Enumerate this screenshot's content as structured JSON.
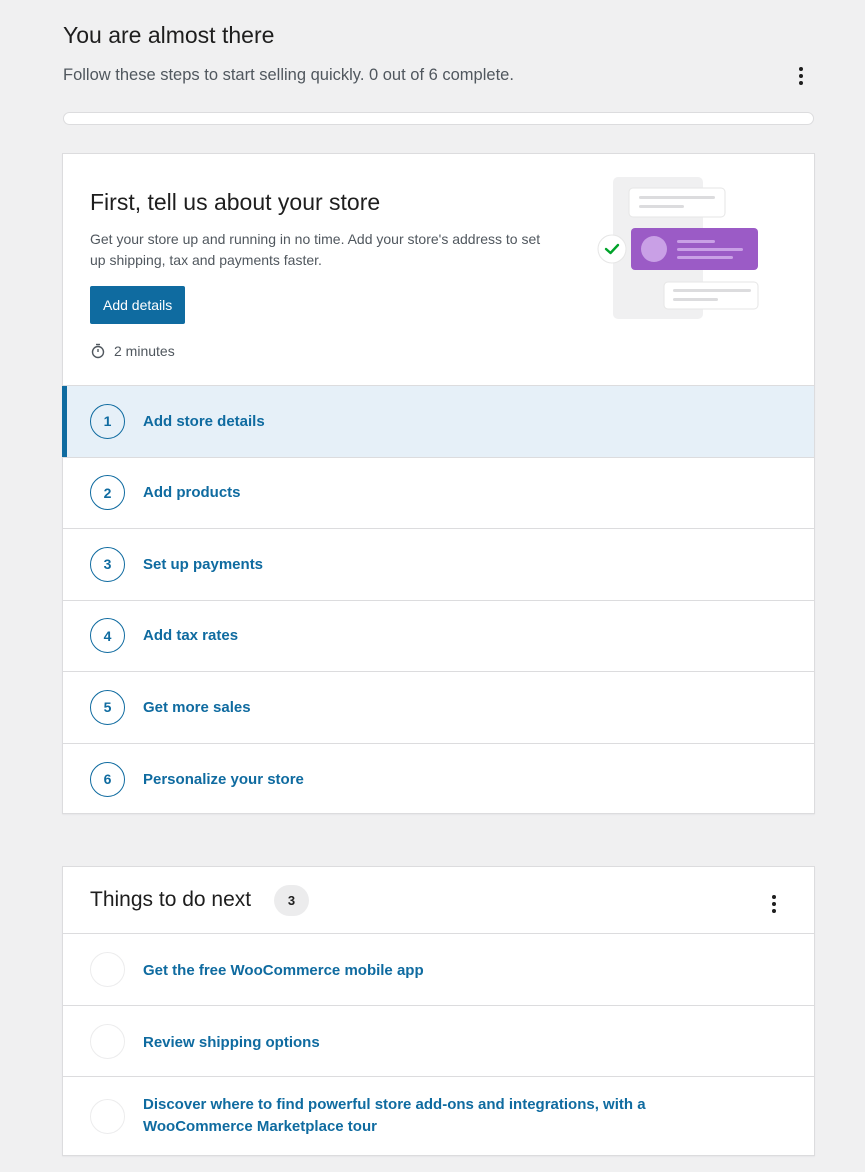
{
  "header": {
    "title": "You are almost there",
    "subtitle": "Follow these steps to start selling quickly. 0 out of 6 complete."
  },
  "progress": {
    "completed": 0,
    "total": 6
  },
  "setup": {
    "hero_title": "First, tell us about your store",
    "hero_description": "Get your store up and running in no time. Add your store's address to set up shipping, tax and payments faster.",
    "button_label": "Add details",
    "time_estimate": "2 minutes",
    "tasks": [
      {
        "number": "1",
        "label": "Add store details"
      },
      {
        "number": "2",
        "label": "Add products"
      },
      {
        "number": "3",
        "label": "Set up payments"
      },
      {
        "number": "4",
        "label": "Add tax rates"
      },
      {
        "number": "5",
        "label": "Get more sales"
      },
      {
        "number": "6",
        "label": "Personalize your store"
      }
    ]
  },
  "next": {
    "title": "Things to do next",
    "count": "3",
    "items": [
      {
        "label": "Get the free WooCommerce mobile app"
      },
      {
        "label": "Review shipping options"
      },
      {
        "label": "Discover where to find powerful store add-ons and integrations, with a WooCommerce Marketplace tour"
      }
    ]
  },
  "colors": {
    "accent": "#0f6ba0",
    "active_row_bg": "#e6f0f8",
    "illustration_purple": "#9b5bc6",
    "check_green": "#00a32a"
  },
  "icons": {
    "more_menu": "more-vertical-icon",
    "timer": "stopwatch-icon",
    "check": "checkmark-icon"
  }
}
